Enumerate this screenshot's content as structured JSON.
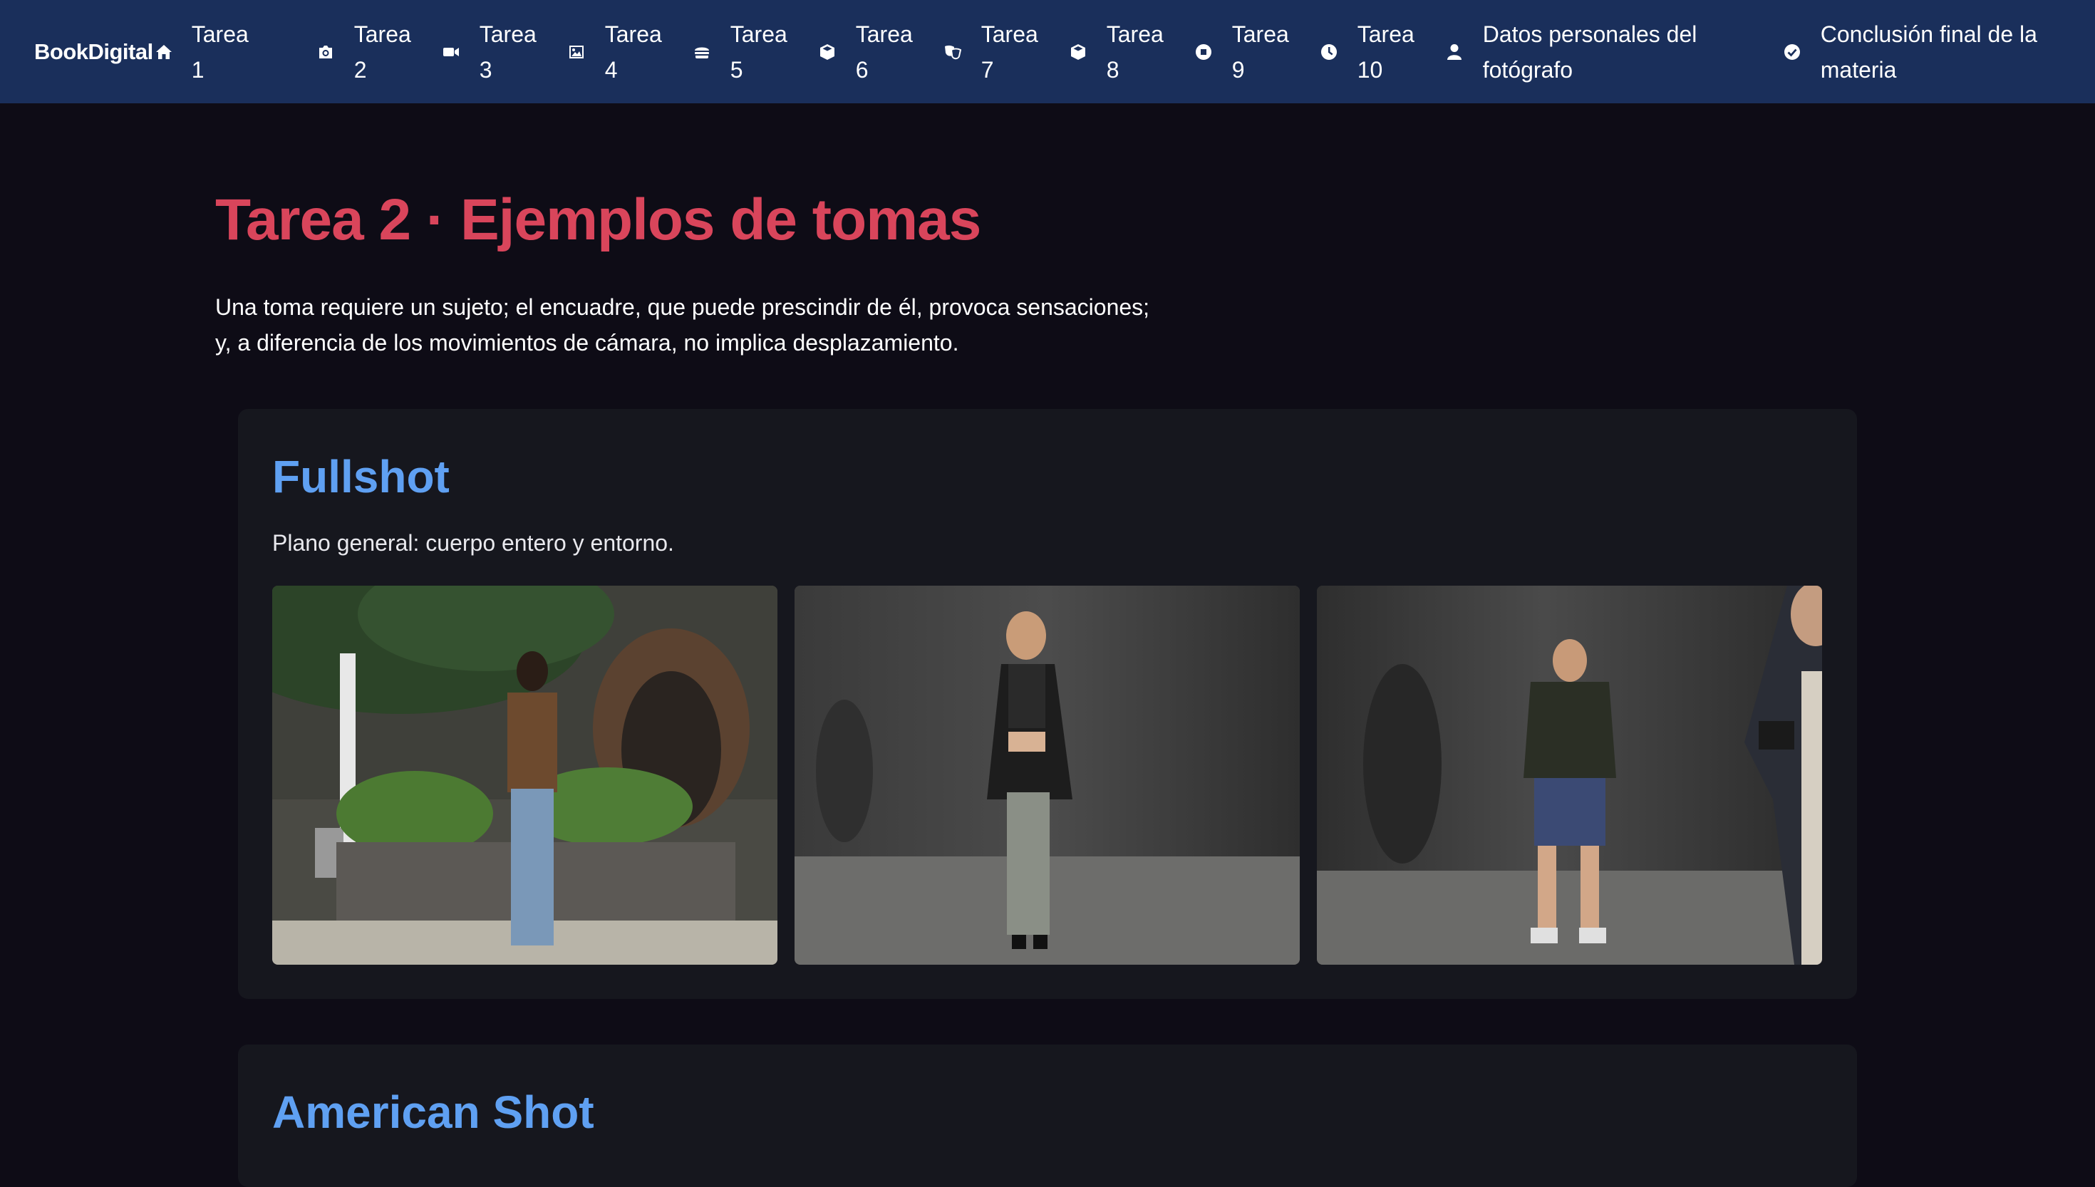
{
  "navbar": {
    "brand": "BookDigital",
    "brand_icon": "house-icon",
    "items": [
      {
        "line1": "Tarea",
        "line2": "1",
        "icon": ""
      },
      {
        "line1": "Tarea",
        "line2": "2",
        "icon": "camera-icon"
      },
      {
        "line1": "Tarea",
        "line2": "3",
        "icon": "video-icon"
      },
      {
        "line1": "Tarea",
        "line2": "4",
        "icon": "image-icon"
      },
      {
        "line1": "Tarea",
        "line2": "5",
        "icon": "burger-icon"
      },
      {
        "line1": "Tarea",
        "line2": "6",
        "icon": "cube-icon"
      },
      {
        "line1": "Tarea",
        "line2": "7",
        "icon": "masks-icon"
      },
      {
        "line1": "Tarea",
        "line2": "8",
        "icon": "cube-icon"
      },
      {
        "line1": "Tarea",
        "line2": "9",
        "icon": "stop-circle-icon"
      },
      {
        "line1": "Tarea",
        "line2": "10",
        "icon": "clock-icon"
      },
      {
        "line1": "Datos personales del",
        "line2": "fotógrafo",
        "icon": "user-icon"
      },
      {
        "line1": "Conclusión final de la",
        "line2": "materia",
        "icon": "check-circle-icon"
      }
    ]
  },
  "page": {
    "title": "Tarea 2 · Ejemplos de tomas",
    "intro_line1": "Una toma requiere un sujeto; el encuadre, que puede prescindir de él, provoca sensaciones;",
    "intro_line2": "y, a diferencia de los movimientos de cámara, no implica desplazamiento."
  },
  "sections": [
    {
      "title": "Fullshot",
      "description": "Plano general: cuerpo entero y entorno.",
      "photos": [
        {
          "scene": "outdoor-garden-woman"
        },
        {
          "scene": "studio-woman-leather-jacket"
        },
        {
          "scene": "studio-man-hoodie-with-photographer"
        }
      ]
    },
    {
      "title": "American Shot"
    }
  ],
  "colors": {
    "navbar_bg": "#1a2f5b",
    "page_bg": "#0e0c16",
    "card_bg": "#16171e",
    "title_red": "#d9455b",
    "section_blue": "#5fa0f2"
  }
}
